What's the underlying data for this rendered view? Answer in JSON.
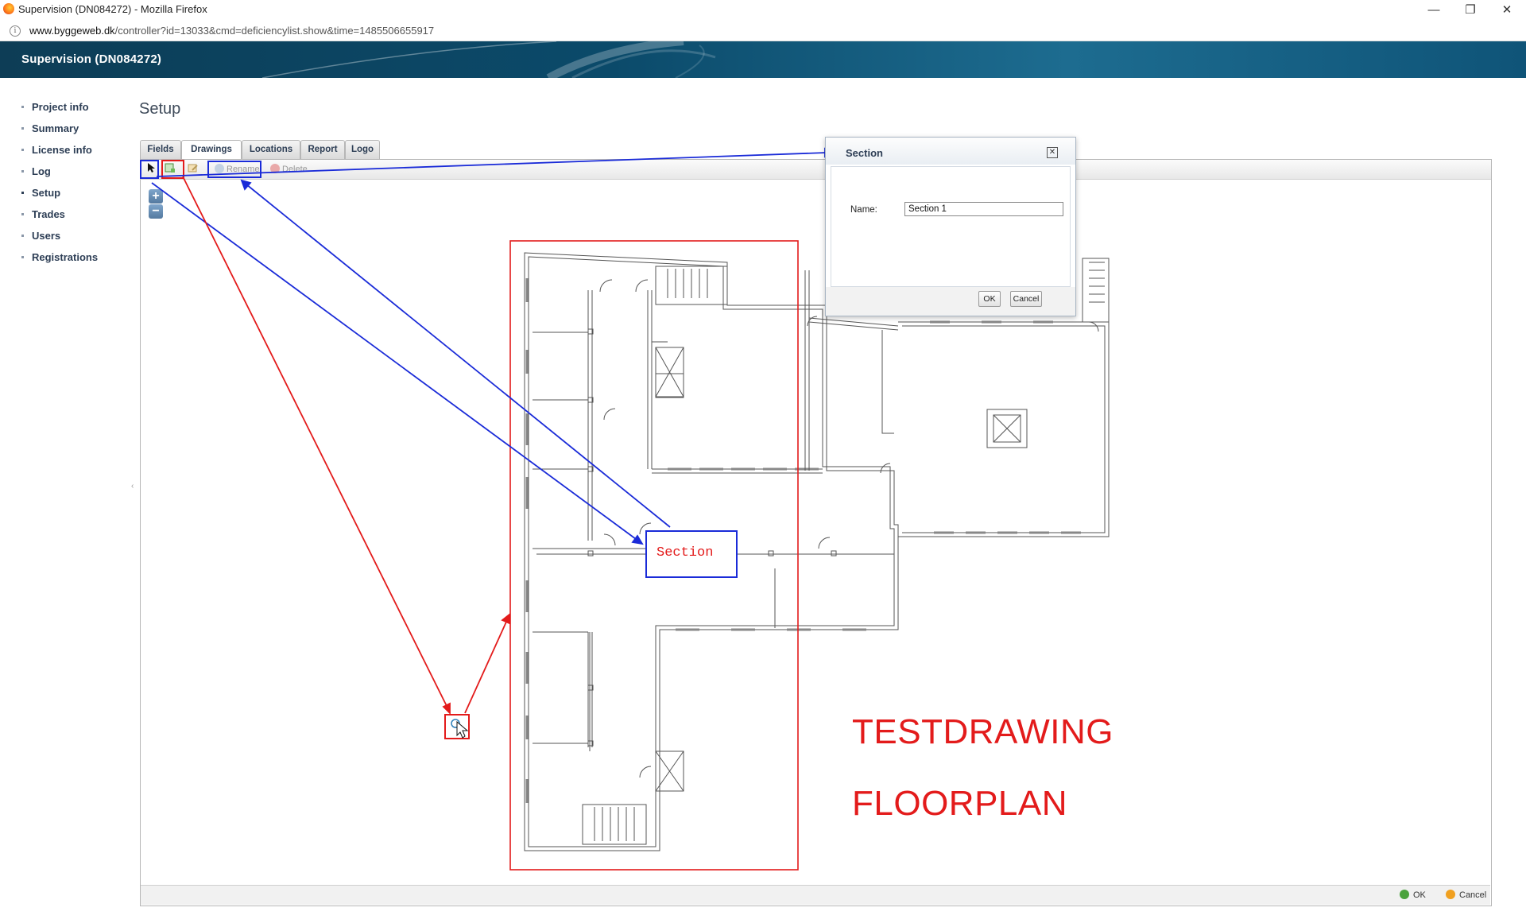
{
  "browser": {
    "window_title": "Supervision (DN084272) - Mozilla Firefox",
    "url_domain": "www.byggeweb.dk",
    "url_path": "/controller?id=13033&cmd=deficiencylist.show&time=1485506655917",
    "controls": {
      "minimize": "—",
      "restore": "❐",
      "close": "✕"
    }
  },
  "app": {
    "title": "Supervision (DN084272)"
  },
  "sidebar": {
    "items": [
      {
        "label": "Project info"
      },
      {
        "label": "Summary"
      },
      {
        "label": "License info"
      },
      {
        "label": "Log"
      },
      {
        "label": "Setup"
      },
      {
        "label": "Trades"
      },
      {
        "label": "Users"
      },
      {
        "label": "Registrations"
      }
    ],
    "active": "Setup"
  },
  "page": {
    "title": "Setup"
  },
  "tabs": [
    {
      "label": "Fields"
    },
    {
      "label": "Drawings"
    },
    {
      "label": "Locations"
    },
    {
      "label": "Report"
    },
    {
      "label": "Logo"
    }
  ],
  "active_tab": "Drawings",
  "toolbar": {
    "rename_label": "Rename",
    "delete_label": "Delete"
  },
  "zoom": {
    "in": "+",
    "out": "−"
  },
  "drawing": {
    "line1": "TESTDRAWING",
    "line2": "FLOORPLAN",
    "section_label": "Section"
  },
  "dialog": {
    "title": "Section",
    "name_label": "Name:",
    "name_value": "Section 1",
    "ok": "OK",
    "cancel": "Cancel"
  },
  "statusbar": {
    "ok": "OK",
    "cancel": "Cancel"
  },
  "colors": {
    "annotation_red": "#e31b1b",
    "annotation_blue": "#1a2bd8",
    "banner": "#0b4a6a"
  }
}
